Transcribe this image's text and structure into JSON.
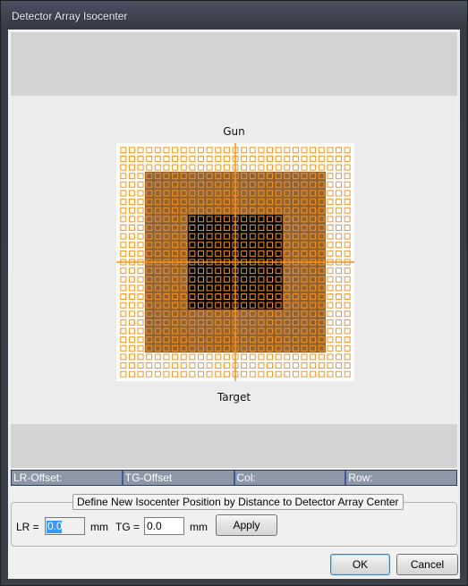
{
  "window": {
    "title": "Detector Array Isocenter"
  },
  "view": {
    "top_label": "Gun",
    "bottom_label": "Target",
    "colors": {
      "detector": "#f7941d",
      "crosshair": "#f7941d",
      "field_outer": "#8a5a2a",
      "field_inner": "#000000"
    },
    "grid": {
      "columns": 27,
      "rows": 27
    }
  },
  "status": {
    "lr_offset_label": "LR-Offset:",
    "tg_offset_label": "TG-Offset",
    "col_label": "Col:",
    "row_label": "Row:"
  },
  "isocenter": {
    "group_title": "Define New Isocenter Position by Distance to Detector Array Center",
    "lr_label": "LR =",
    "lr_value": "0.0",
    "lr_unit": "mm",
    "tg_label": "TG =",
    "tg_value": "0.0",
    "tg_unit": "mm",
    "apply_label": "Apply"
  },
  "footer": {
    "ok_label": "OK",
    "cancel_label": "Cancel"
  }
}
